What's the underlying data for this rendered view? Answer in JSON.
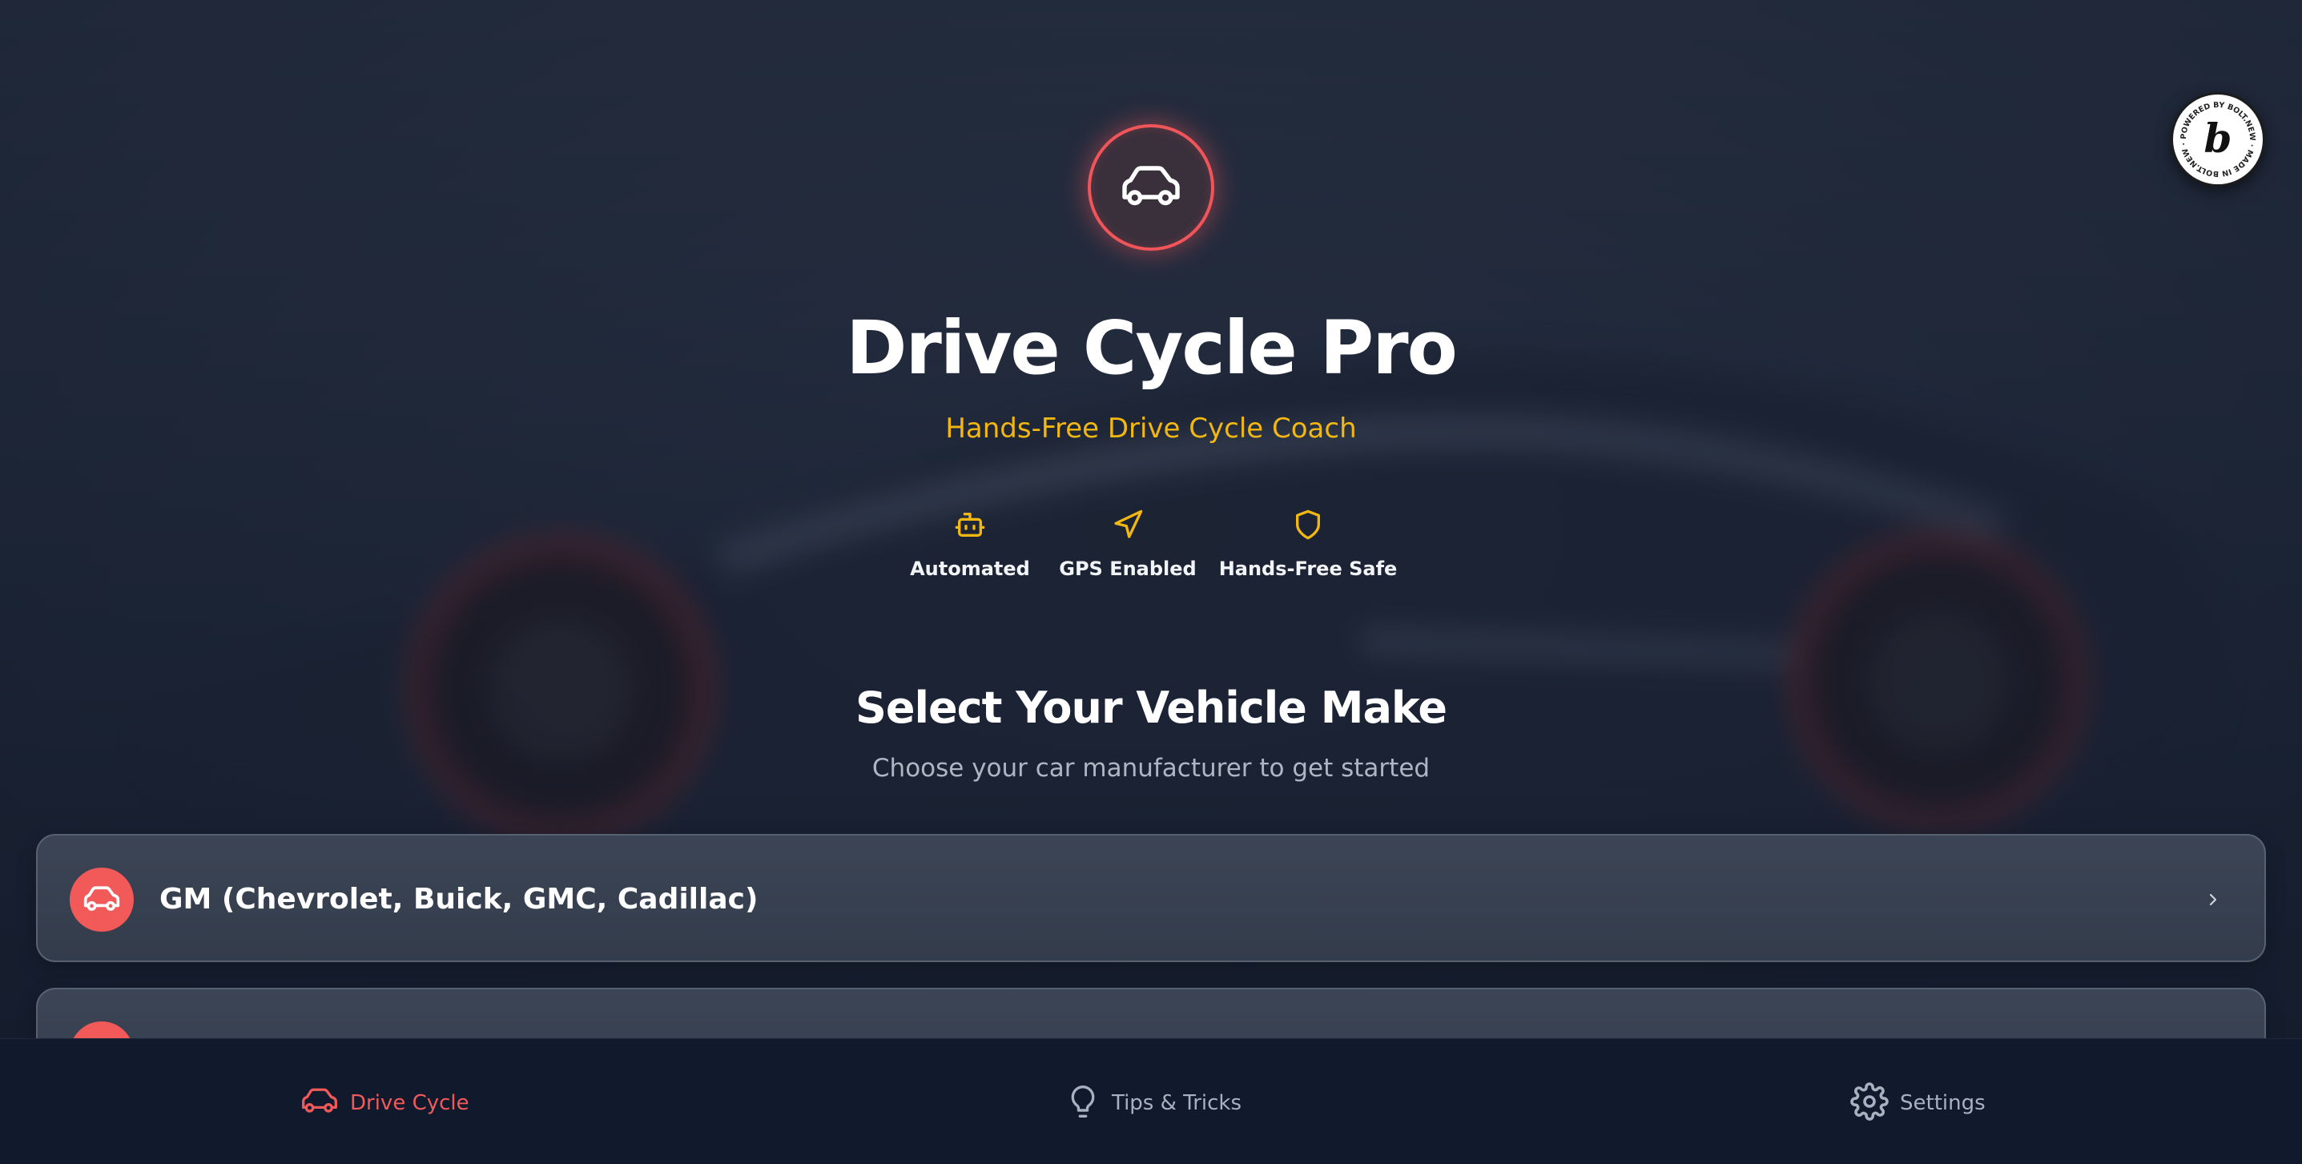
{
  "hero": {
    "icon": "car-icon",
    "title": "Drive Cycle Pro",
    "subtitle": "Hands-Free Drive Cycle Coach"
  },
  "features": [
    {
      "icon": "robot-icon",
      "label": "Automated"
    },
    {
      "icon": "navigation-icon",
      "label": "GPS Enabled"
    },
    {
      "icon": "shield-icon",
      "label": "Hands-Free Safe"
    }
  ],
  "section": {
    "title": "Select Your Vehicle Make",
    "subtitle": "Choose your car manufacturer to get started"
  },
  "makes": [
    {
      "label": "GM (Chevrolet, Buick, GMC, Cadillac)"
    },
    {
      "label": ""
    }
  ],
  "badge": {
    "text": "POWERED BY BOLT.NEW · MADE IN BOLT.NEW ·",
    "letter": "b"
  },
  "nav": {
    "items": [
      {
        "label": "Drive Cycle",
        "icon": "car-icon",
        "active": true
      },
      {
        "label": "Tips & Tricks",
        "icon": "lightbulb-icon",
        "active": false
      },
      {
        "label": "Settings",
        "icon": "gear-icon",
        "active": false
      }
    ]
  },
  "colors": {
    "accent": "#f25959",
    "gold": "#f3b712",
    "background": "#141c2c",
    "nav_background": "#111a2d"
  }
}
